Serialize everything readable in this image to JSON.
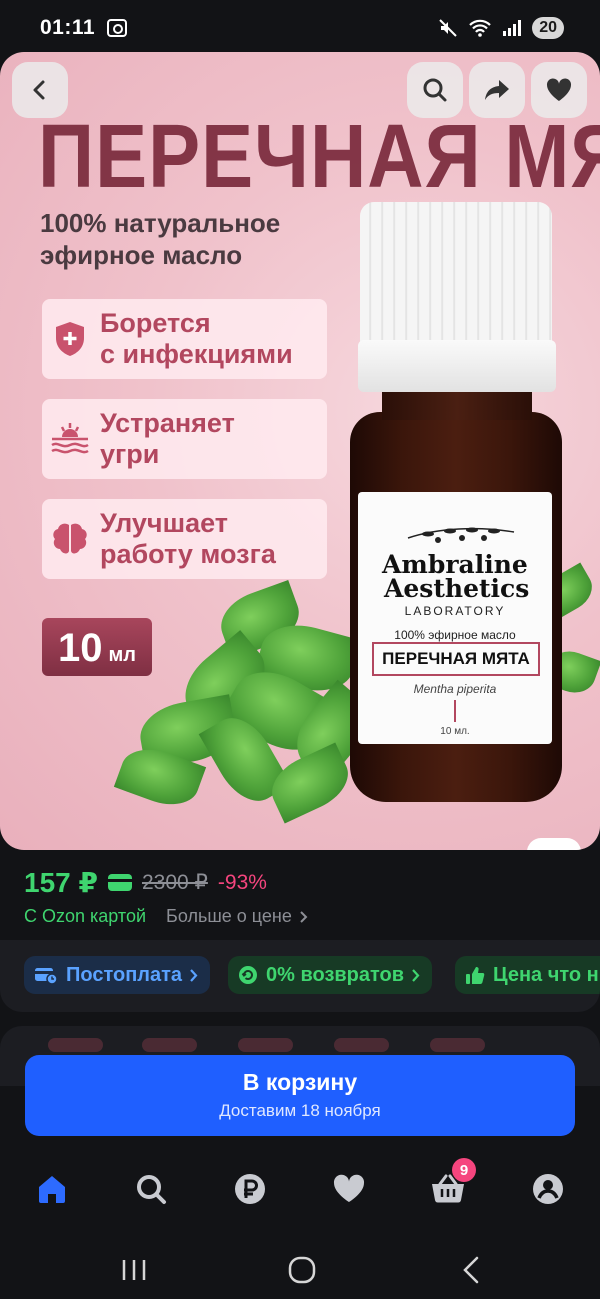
{
  "status_bar": {
    "time": "01:11",
    "battery": "20",
    "icons": [
      "screenshot-icon",
      "mute-icon",
      "wifi-icon",
      "signal-icon"
    ]
  },
  "product_image": {
    "headline": "ПЕРЕЧНАЯ МЯТА",
    "subtitle": "100% натуральное эфирное масло",
    "benefits": [
      {
        "icon": "shield-plus-icon",
        "line1": "Борется",
        "line2": "с инфекциями"
      },
      {
        "icon": "skin-icon",
        "line1": "Устраняет",
        "line2": "угри"
      },
      {
        "icon": "brain-icon",
        "line1": "Улучшает",
        "line2": "работу мозга"
      }
    ],
    "volume_number": "10",
    "volume_unit": "мл",
    "bottle_label": {
      "brand_line1": "Ambraline",
      "brand_line2": "Aesthetics",
      "laboratory": "LABORATORY",
      "oil_type": "100% эфирное масло",
      "name": "ПЕРЕЧНАЯ МЯТА",
      "latin": "Mentha piperita",
      "volume": "10 мл."
    },
    "overlay_icons": [
      "back-icon",
      "search-icon",
      "share-icon",
      "heart-icon",
      "image-search-icon"
    ]
  },
  "price": {
    "current": "157 ₽",
    "old": "2300 ₽",
    "discount": "-93%",
    "ozon_card_label": "С Ozon картой",
    "more_label": "Больше о цене"
  },
  "chips": [
    {
      "label": "Постоплата",
      "icon": "card-clock-icon"
    },
    {
      "label": "0% возвратов",
      "icon": "return-icon"
    },
    {
      "label": "Цена что н",
      "icon": "thumb-up-icon"
    }
  ],
  "cart_button": {
    "title": "В корзину",
    "subtitle": "Доставим 18 ноября"
  },
  "bottom_nav": {
    "items": [
      "home-icon",
      "search-icon",
      "ruble-icon",
      "heart-icon",
      "cart-icon",
      "profile-icon"
    ],
    "cart_badge": "9"
  },
  "colors": {
    "accent_green": "#3fd56f",
    "accent_blue": "#1f5fff",
    "discount_pink": "#f5457e"
  }
}
